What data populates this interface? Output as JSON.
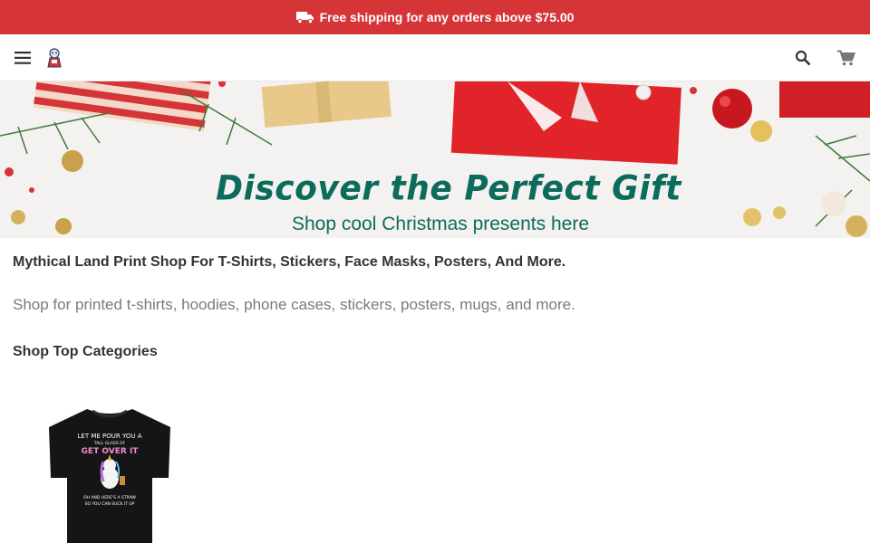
{
  "promo": {
    "text": "Free shipping for any orders above $75.00",
    "icon": "truck-icon",
    "color": "#d63538"
  },
  "header": {
    "menu_icon": "menu-icon",
    "logo": "shop-logo",
    "search_icon": "search-icon",
    "cart_icon": "cart-icon"
  },
  "hero": {
    "title": "Discover the Perfect Gift",
    "subtitle": "Shop cool Christmas presents here",
    "accent": "#0c6b5b"
  },
  "main": {
    "heading": "Mythical Land Print Shop For T-Shirts, Stickers, Face Masks, Posters, And More.",
    "description": "Shop for printed t-shirts, hoodies, phone cases, stickers, posters, mugs, and more.",
    "categories_heading": "Shop Top Categories"
  },
  "products": [
    {
      "image": "unicorn-t-shirt",
      "print_line1": "LET ME POUR YOU A",
      "print_line2": "TALL GLASS OF",
      "print_line3": "GET OVER IT",
      "print_line4": "OH AND HERE'S A STRAW",
      "print_line5": "SO YOU CAN SUCK IT UP"
    }
  ]
}
